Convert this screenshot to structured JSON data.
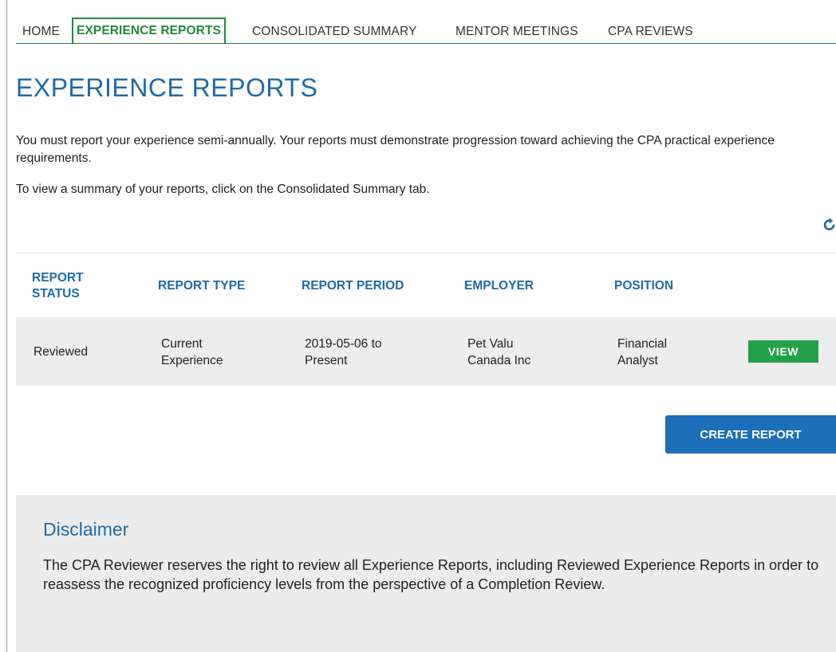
{
  "nav": {
    "items": [
      {
        "label": "HOME",
        "active": false
      },
      {
        "label": "EXPERIENCE REPORTS",
        "active": true
      },
      {
        "label": "CONSOLIDATED SUMMARY",
        "active": false
      },
      {
        "label": "MENTOR MEETINGS",
        "active": false
      },
      {
        "label": "CPA REVIEWS",
        "active": false
      }
    ]
  },
  "page": {
    "title": "EXPERIENCE REPORTS",
    "intro": "You must report your experience semi-annually. Your reports must demonstrate progression toward achieving the CPA practical experience requirements.",
    "intro2": "To view a summary of your reports, click on the Consolidated Summary tab."
  },
  "icons": {
    "refresh": "refresh-icon"
  },
  "table": {
    "headers": {
      "status_line1": "REPORT",
      "status_line2": "STATUS",
      "type": "REPORT TYPE",
      "period": "REPORT PERIOD",
      "employer": "EMPLOYER",
      "position": "POSITION"
    },
    "rows": [
      {
        "status": "Reviewed",
        "type_line1": "Current",
        "type_line2": "Experience",
        "period_line1": "2019-05-06 to",
        "period_line2": "Present",
        "employer_line1": "Pet Valu",
        "employer_line2": "Canada Inc",
        "position_line1": "Financial",
        "position_line2": "Analyst",
        "action": "VIEW"
      }
    ]
  },
  "actions": {
    "create": "CREATE REPORT"
  },
  "disclaimer": {
    "title": "Disclaimer",
    "text": "The CPA Reviewer reserves the right to review all Experience Reports, including Reviewed Experience Reports in order to reassess the recognized proficiency levels from the perspective of a Completion Review."
  },
  "colors": {
    "nav_active": "#1e8a3c",
    "heading_blue": "#1f6aa5",
    "view_button": "#23a04a",
    "create_button": "#1c6fb8",
    "row_bg": "#ededed",
    "disclaimer_bg": "#ececec"
  }
}
